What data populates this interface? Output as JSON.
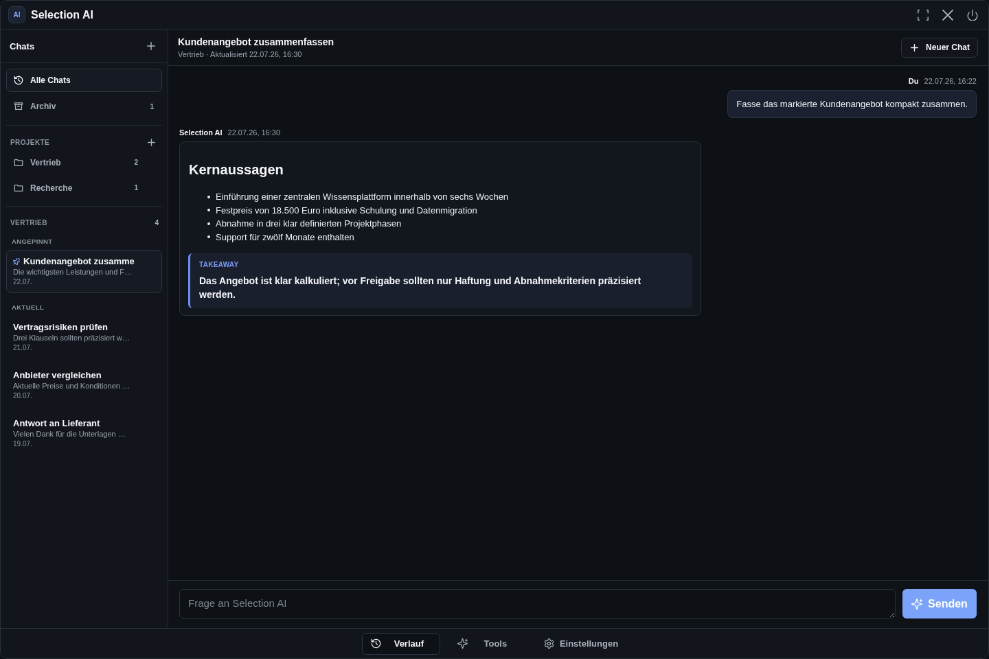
{
  "window": {
    "logo": "AI",
    "title": "Selection AI"
  },
  "sidebar": {
    "title": "Chats",
    "nav": [
      {
        "kind": "history",
        "label": "Alle Chats",
        "selected": true
      },
      {
        "kind": "archive",
        "label": "Archiv",
        "count": "1",
        "selected": false
      }
    ],
    "projects": {
      "heading": "PROJEKTE",
      "items": [
        {
          "label": "Vertrieb",
          "count": "2",
          "selected": false
        },
        {
          "label": "Recherche",
          "count": "1",
          "selected": false
        }
      ]
    },
    "group": {
      "heading": "VERTRIEB",
      "count": "4",
      "sections": [
        {
          "label": "ANGEPINNT",
          "chats": [
            {
              "title": "Kundenangebot zusamme",
              "preview": "Die wichtigsten Leistungen und F…",
              "date": "22.07.",
              "pinned": true,
              "selected": true
            }
          ]
        },
        {
          "label": "AKTUELL",
          "chats": [
            {
              "title": "Vertragsrisiken prüfen",
              "preview": "Drei Klauseln sollten präzisiert w…",
              "date": "21.07.",
              "pinned": false,
              "selected": false
            },
            {
              "title": "Anbieter vergleichen",
              "preview": "Aktuelle Preise und Konditionen …",
              "date": "20.07.",
              "pinned": false,
              "selected": false
            },
            {
              "title": "Antwort an Lieferant",
              "preview": "Vielen Dank für die Unterlagen …",
              "date": "19.07.",
              "pinned": false,
              "selected": false
            }
          ]
        }
      ]
    }
  },
  "chat": {
    "title": "Kundenangebot zusammenfassen",
    "subtitle": "Vertrieb · Aktualisiert 22.07.26, 16:30",
    "new_button": "Neuer Chat",
    "messages": [
      {
        "kind": "user",
        "author": "Du",
        "time": "22.07.26, 16:22",
        "text": "Fasse das markierte Kundenangebot kompakt zusammen."
      },
      {
        "kind": "assistant",
        "author": "Selection AI",
        "time": "22.07.26, 16:30",
        "heading": "Kernaussagen",
        "bullets": [
          "Einführung einer zentralen Wissensplattform innerhalb von sechs Wochen",
          "Festpreis von 18.500 Euro inklusive Schulung und Datenmigration",
          "Abnahme in drei klar definierten Projektphasen",
          "Support für zwölf Monate enthalten"
        ],
        "takeaway": {
          "label": "TAKEAWAY",
          "text": "Das Angebot ist klar kalkuliert; vor Freigabe sollten nur Haftung und Abnahmekriterien präzisiert werden."
        }
      }
    ],
    "composer": {
      "placeholder": "Frage an Selection AI",
      "send_button": "Senden"
    }
  },
  "bottom_nav": [
    {
      "kind": "history",
      "label": "Verlauf",
      "selected": true
    },
    {
      "kind": "sparkle",
      "label": "Tools",
      "selected": false
    },
    {
      "kind": "gear",
      "label": "Einstellungen",
      "selected": false
    }
  ]
}
